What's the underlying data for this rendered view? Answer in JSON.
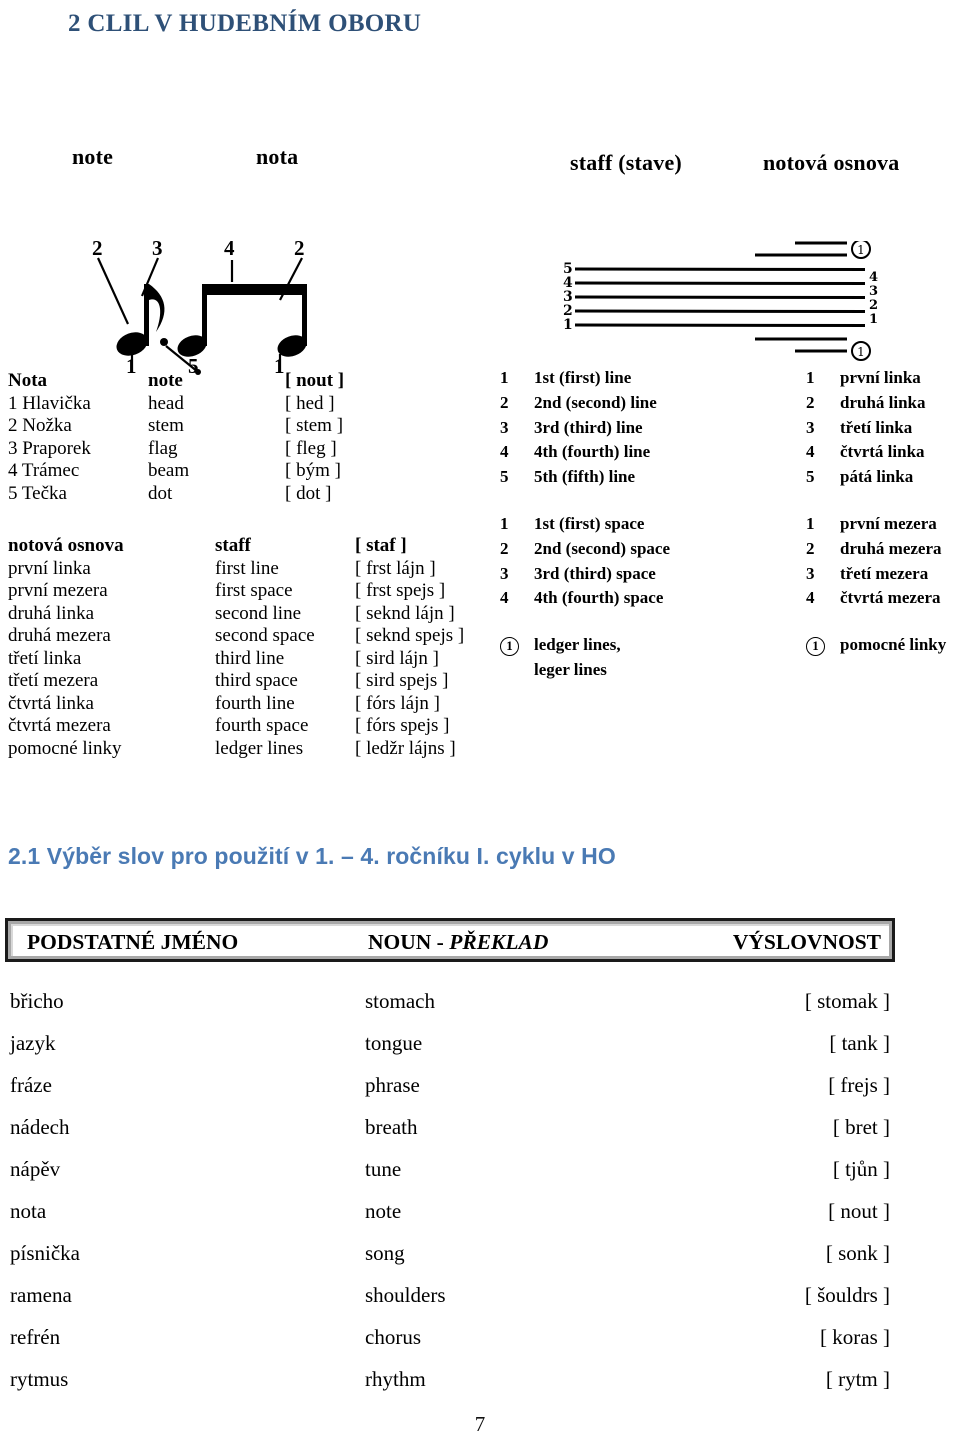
{
  "document": {
    "title": "2 CLIL V HUDEBNÍM OBORU",
    "section_title": "2.1 Výběr slov pro použití v 1. – 4. ročníku I. cyklu v HO",
    "page_number": "7",
    "title_color": "#2E5077",
    "section_title_color": "#4a7ab4"
  },
  "figure": {
    "label_note_en": "note",
    "label_note_cz": "nota",
    "label_staff_en": "staff (stave)",
    "label_staff_cz": "notová osnova",
    "note_callouts": [
      "2",
      "3",
      "4",
      "2",
      "1",
      "5",
      "1"
    ],
    "staff_line_numbers": [
      "5",
      "4",
      "3",
      "2",
      "1"
    ],
    "staff_space_numbers": [
      "4",
      "3",
      "2",
      "1"
    ],
    "ledger_marker": "1"
  },
  "glossary_note": {
    "rows": [
      {
        "cz": "Nota",
        "en": "note",
        "pron": "[ nout ]",
        "bold": true
      },
      {
        "cz": "1 Hlavička",
        "en": "head",
        "pron": "[ hed ]",
        "bold": false
      },
      {
        "cz": "2 Nožka",
        "en": "stem",
        "pron": "[ stem ]",
        "bold": false
      },
      {
        "cz": "3 Praporek",
        "en": "flag",
        "pron": "[ fleg ]",
        "bold": false
      },
      {
        "cz": "4 Trámec",
        "en": "beam",
        "pron": "[ bým ]",
        "bold": false
      },
      {
        "cz": "5 Tečka",
        "en": "dot",
        "pron": "[ dot ]",
        "bold": false
      }
    ]
  },
  "glossary_staff": {
    "rows": [
      {
        "cz": "notová osnova",
        "en": "staff",
        "pron": "[ staf ]",
        "bold": true
      },
      {
        "cz": "první linka",
        "en": "first line",
        "pron": "[ frst lájn ]",
        "bold": false
      },
      {
        "cz": "první mezera",
        "en": "first space",
        "pron": "[ frst spejs ]",
        "bold": false
      },
      {
        "cz": "druhá linka",
        "en": "second line",
        "pron": "[ seknd lájn ]",
        "bold": false
      },
      {
        "cz": "druhá mezera",
        "en": "second space",
        "pron": "[ seknd spejs ]",
        "bold": false
      },
      {
        "cz": "třetí linka",
        "en": "third line",
        "pron": "[ sird lájn ]",
        "bold": false
      },
      {
        "cz": "třetí mezera",
        "en": "third space",
        "pron": "[ sird spejs ]",
        "bold": false
      },
      {
        "cz": "čtvrtá linka",
        "en": "fourth line",
        "pron": "[ fórs lájn ]",
        "bold": false
      },
      {
        "cz": "čtvrtá mezera",
        "en": "fourth space",
        "pron": "[ fórs spejs ]",
        "bold": false
      },
      {
        "cz": "pomocné linky",
        "en": "ledger lines",
        "pron": "[ ledžr lájns ]",
        "bold": false
      }
    ]
  },
  "legend_en": {
    "lines": [
      {
        "num": "1",
        "text": "1st (first) line"
      },
      {
        "num": "2",
        "text": "2nd (second) line"
      },
      {
        "num": "3",
        "text": "3rd (third) line"
      },
      {
        "num": "4",
        "text": "4th (fourth) line"
      },
      {
        "num": "5",
        "text": "5th (fifth) line"
      }
    ],
    "spaces": [
      {
        "num": "1",
        "text": "1st (first) space"
      },
      {
        "num": "2",
        "text": "2nd (second) space"
      },
      {
        "num": "3",
        "text": "3rd (third) space"
      },
      {
        "num": "4",
        "text": "4th (fourth) space"
      }
    ],
    "ledger": {
      "num": "1",
      "text": "ledger lines,",
      "text2": "leger lines"
    }
  },
  "legend_cz": {
    "lines": [
      {
        "num": "1",
        "text": "první linka"
      },
      {
        "num": "2",
        "text": "druhá linka"
      },
      {
        "num": "3",
        "text": "třetí linka"
      },
      {
        "num": "4",
        "text": "čtvrtá linka"
      },
      {
        "num": "5",
        "text": "pátá linka"
      }
    ],
    "spaces": [
      {
        "num": "1",
        "text": "první mezera"
      },
      {
        "num": "2",
        "text": "druhá mezera"
      },
      {
        "num": "3",
        "text": "třetí mezera"
      },
      {
        "num": "4",
        "text": "čtvrtá mezera"
      }
    ],
    "ledger": {
      "num": "1",
      "text": "pomocné linky",
      "text2": ""
    }
  },
  "vocab_table": {
    "headers": {
      "col1": "PODSTATNÉ JMÉNO",
      "col2_plain": "NOUN - ",
      "col2_italic": "PŘEKLAD",
      "col3": "VÝSLOVNOST"
    },
    "rows": [
      {
        "cz": "břicho",
        "en": "stomach",
        "pron": "[ stomak ]"
      },
      {
        "cz": "jazyk",
        "en": "tongue",
        "pron": "[ tank ]"
      },
      {
        "cz": "fráze",
        "en": "phrase",
        "pron": "[ frejs ]"
      },
      {
        "cz": "nádech",
        "en": "breath",
        "pron": "[ bret ]"
      },
      {
        "cz": "nápěv",
        "en": "tune",
        "pron": "[ tjůn ]"
      },
      {
        "cz": "nota",
        "en": "note",
        "pron": "[ nout ]"
      },
      {
        "cz": "písnička",
        "en": "song",
        "pron": "[ sonk ]"
      },
      {
        "cz": "ramena",
        "en": "shoulders",
        "pron": "[ šouldrs ]"
      },
      {
        "cz": "refrén",
        "en": "chorus",
        "pron": "[ koras ]"
      },
      {
        "cz": "rytmus",
        "en": "rhythm",
        "pron": "[ rytm ]"
      }
    ]
  }
}
